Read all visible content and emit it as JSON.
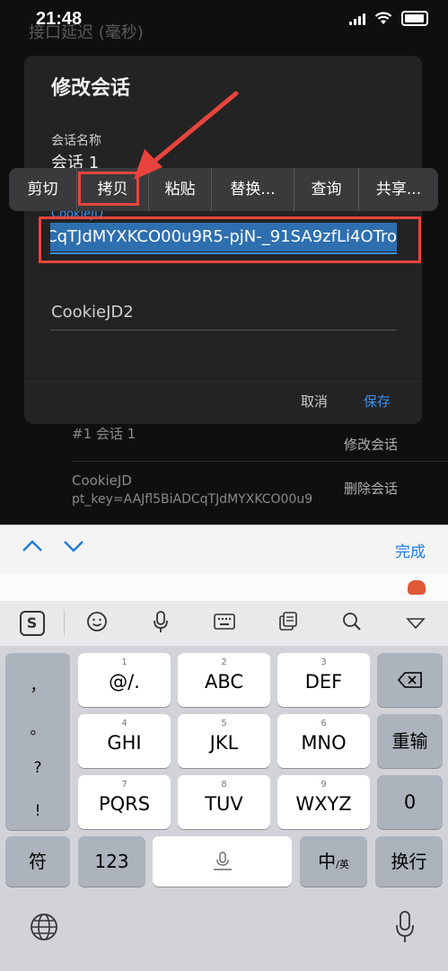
{
  "status": {
    "time": "21:48"
  },
  "background": {
    "header": "接口延迟 (毫秒)"
  },
  "dialog": {
    "title": "修改会话",
    "session_name_label": "会话名称",
    "session_name_value": "会话 1",
    "cookie_label": "CookieJD",
    "cookie_value": "AAJfl5BiADCqTJdMYXKCO00u9R5-pjN-_91SA9zfLi4OTro",
    "cookie2_placeholder": "CookieJD2",
    "cancel": "取消",
    "save": "保存"
  },
  "context_menu": [
    "剪切",
    "拷贝",
    "粘贴",
    "替换...",
    "查询",
    "共享..."
  ],
  "list": {
    "item1": "#1 会话 1",
    "edit": "修改会话",
    "item2_title": "CookieJD",
    "item2_value": "pt_key=AAJfl5BiADCqTJdMYXKCO00u9",
    "delete": "删除会话"
  },
  "keyboard": {
    "done": "完成",
    "punct": [
      "，",
      "。",
      "?",
      "!"
    ],
    "keys": [
      {
        "sup": "1",
        "main": "@/."
      },
      {
        "sup": "2",
        "main": "ABC"
      },
      {
        "sup": "3",
        "main": "DEF"
      },
      {
        "sup": "4",
        "main": "GHI"
      },
      {
        "sup": "5",
        "main": "JKL"
      },
      {
        "sup": "6",
        "main": "MNO"
      },
      {
        "sup": "7",
        "main": "PQRS"
      },
      {
        "sup": "8",
        "main": "TUV"
      },
      {
        "sup": "9",
        "main": "WXYZ"
      }
    ],
    "retype": "重输",
    "zero": "0",
    "symbol": "符",
    "num": "123",
    "zh": "中",
    "zh_sub": "/英",
    "enter": "换行"
  },
  "colors": {
    "accent": "#3b8ff0",
    "highlight": "#e8443d"
  }
}
